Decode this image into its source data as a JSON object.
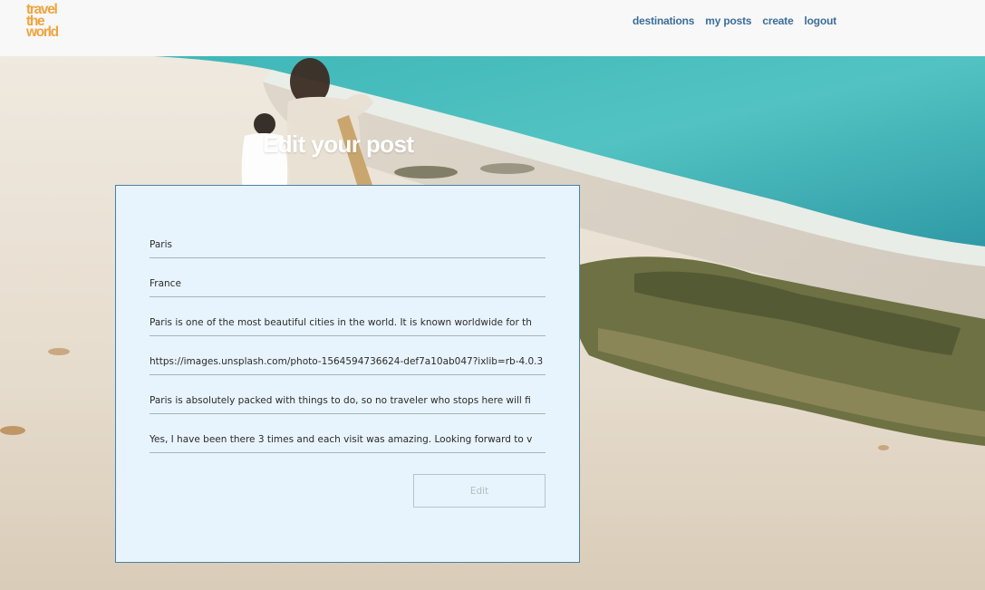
{
  "logo": {
    "lines": [
      "travel",
      "the",
      "world"
    ]
  },
  "nav": [
    {
      "label": "destinations"
    },
    {
      "label": "my posts"
    },
    {
      "label": "create"
    },
    {
      "label": "logout"
    }
  ],
  "page_title": "Edit your post",
  "form": {
    "fields": [
      {
        "name": "city",
        "value": "Paris"
      },
      {
        "name": "country",
        "value": "France"
      },
      {
        "name": "description",
        "value": "Paris is one of the most beautiful cities in the world. It is known worldwide for th"
      },
      {
        "name": "image-url",
        "value": "https://images.unsplash.com/photo-1564594736624-def7a10ab047?ixlib=rb-4.0.3"
      },
      {
        "name": "things-to-do",
        "value": "Paris is absolutely packed with things to do, so no traveler who stops here will fi"
      },
      {
        "name": "personal-experience",
        "value": "Yes, I have been there 3 times and each visit was amazing. Looking forward to v"
      }
    ],
    "submit_label": "Edit"
  },
  "colors": {
    "logo": "#f0a43e",
    "nav_link": "#3b6e9a",
    "form_background": "#e8f4fd",
    "form_border": "#4a7fa5"
  }
}
